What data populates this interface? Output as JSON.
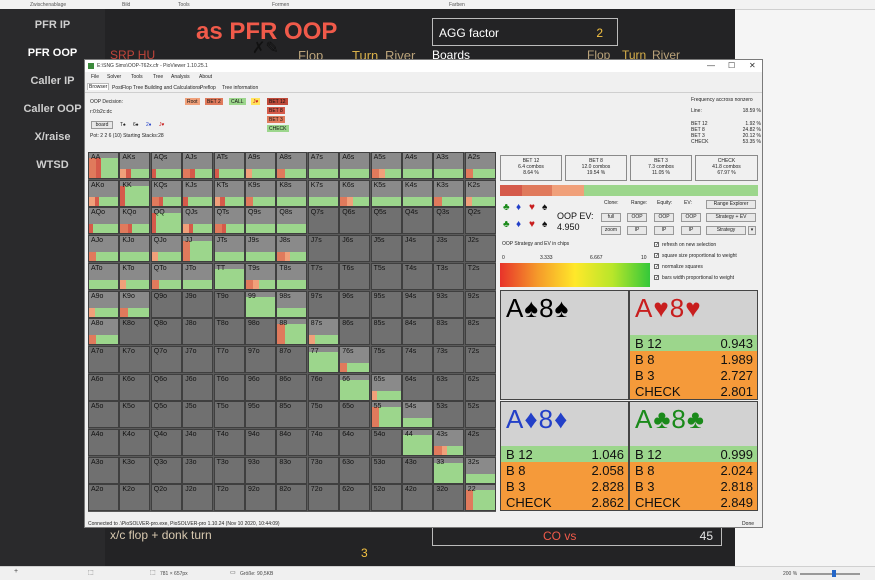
{
  "topbar": {
    "clipboard": "Zwischenablage",
    "images": "Bild",
    "tools": "Tools",
    "shapes": "Formen",
    "colors": "Farben"
  },
  "nav": {
    "items": [
      "PFR IP",
      "PFR OOP",
      "Caller IP",
      "Caller OOP",
      "X/raise",
      "WTSD"
    ]
  },
  "slide": {
    "title": "as PFR OOP",
    "srp": "SRP HU",
    "flop": "Flop",
    "turn": "Turn",
    "river": "River",
    "agg_label": "AGG factor",
    "agg_value": "2",
    "boards_label": "Boards",
    "xc": "x/c flop + donk turn",
    "three": "3",
    "co_label": "CO vs",
    "co_value": "45"
  },
  "window": {
    "title": "E:\\SNG Sims\\OOP-T62x.cfr - PioViewer 1.10.25.1",
    "minimize": "—",
    "maximize": "☐",
    "close": "✕",
    "menu": [
      "File",
      "Solver",
      "Tools",
      "Tree",
      "Analysis",
      "About"
    ],
    "tabs": [
      "Browser",
      "PostFlop Tree Building and Calculations",
      "Preflop",
      "Tree information"
    ],
    "oop_decision": "OOP Decision:",
    "node": "r:0:b2c:dc",
    "board_btn": "board",
    "board_cards": [
      "T♠",
      "6♠",
      "2♦",
      "J♥"
    ],
    "pot": "Pot: 2 2 6 (10) Starting Stacks:28",
    "tree_actions": [
      "Root",
      "BET 2",
      "CALL",
      "J♥",
      "BET 12",
      "BET 8",
      "BET 3",
      "CHECK"
    ],
    "freq_title": "Frequency accross nonzero",
    "freq": [
      {
        "k": "Line:",
        "v": "18.59 %"
      },
      {
        "k": "BET 12",
        "v": "1.92 %"
      },
      {
        "k": "BET 8",
        "v": "24.82 %"
      },
      {
        "k": "BET 3",
        "v": "20.12 %"
      },
      {
        "k": "CHECK",
        "v": "53.35 %"
      }
    ],
    "status_left": "Connected to .\\PioSOLVER-pro.exe, PioSOLVER-pro 1.10.24 (Nov 10 2020, 10:44:09)",
    "status_right": "Done"
  },
  "summary": [
    {
      "name": "BET 12",
      "combos": "6.4 combos",
      "pct": "8.64 %",
      "color": "#d55a4a"
    },
    {
      "name": "BET 8",
      "combos": "12.0 combos",
      "pct": "19.54 %",
      "color": "#e07a5c"
    },
    {
      "name": "BET 3",
      "combos": "7.3 combos",
      "pct": "11.05 %",
      "color": "#f0a07a"
    },
    {
      "name": "CHECK",
      "combos": "41.8 combos",
      "pct": "67.97 %",
      "color": "#9cd68c"
    }
  ],
  "controls": {
    "oop_ev_label": "OOP EV:",
    "oop_ev_value": "4.950",
    "clone": "Clone:",
    "range": "Range:",
    "equity": "Equity:",
    "ev": "EV:",
    "full": "full",
    "zoom": "zoom",
    "oop": "OOP",
    "ip": "IP",
    "range_explorer": "Range Explorer",
    "strategy_ev": "Strategy + EV",
    "strategy": "Strategy",
    "legend_caption": "OOP Strategy and EV in chips",
    "scale": [
      "0",
      "3.333",
      "6.667",
      "10"
    ],
    "options": [
      "refresh on new selection",
      "square size proportional to weight",
      "normalize squares",
      "bars width proportional to weight"
    ]
  },
  "hands": [
    "AA",
    "AKs",
    "AQs",
    "AJs",
    "ATs",
    "A9s",
    "A8s",
    "A7s",
    "A6s",
    "A5s",
    "A4s",
    "A3s",
    "A2s",
    "AKo",
    "KK",
    "KQs",
    "KJs",
    "KTs",
    "K9s",
    "K8s",
    "K7s",
    "K6s",
    "K5s",
    "K4s",
    "K3s",
    "K2s",
    "AQo",
    "KQo",
    "QQ",
    "QJs",
    "QTs",
    "Q9s",
    "Q8s",
    "Q7s",
    "Q6s",
    "Q5s",
    "Q4s",
    "Q3s",
    "Q2s",
    "AJo",
    "KJo",
    "QJo",
    "JJ",
    "JTs",
    "J9s",
    "J8s",
    "J7s",
    "J6s",
    "J5s",
    "J4s",
    "J3s",
    "J2s",
    "ATo",
    "KTo",
    "QTo",
    "JTo",
    "TT",
    "T9s",
    "T8s",
    "T7s",
    "T6s",
    "T5s",
    "T4s",
    "T3s",
    "T2s",
    "A9o",
    "K9o",
    "Q9o",
    "J9o",
    "T9o",
    "99",
    "98s",
    "97s",
    "96s",
    "95s",
    "94s",
    "93s",
    "92s",
    "A8o",
    "K8o",
    "Q8o",
    "J8o",
    "T8o",
    "98o",
    "88",
    "87s",
    "86s",
    "85s",
    "84s",
    "83s",
    "82s",
    "A7o",
    "K7o",
    "Q7o",
    "J7o",
    "T7o",
    "97o",
    "87o",
    "77",
    "76s",
    "75s",
    "74s",
    "73s",
    "72s",
    "A6o",
    "K6o",
    "Q6o",
    "J6o",
    "T6o",
    "96o",
    "86o",
    "76o",
    "66",
    "65s",
    "64s",
    "63s",
    "62s",
    "A5o",
    "K5o",
    "Q5o",
    "J5o",
    "T5o",
    "95o",
    "85o",
    "75o",
    "65o",
    "55",
    "54s",
    "53s",
    "52s",
    "A4o",
    "K4o",
    "Q4o",
    "J4o",
    "T4o",
    "94o",
    "84o",
    "74o",
    "64o",
    "54o",
    "44",
    "43s",
    "42s",
    "A3o",
    "K3o",
    "Q3o",
    "J3o",
    "T3o",
    "93o",
    "83o",
    "73o",
    "63o",
    "53o",
    "43o",
    "33",
    "32s",
    "A2o",
    "K2o",
    "Q2o",
    "J2o",
    "T2o",
    "92o",
    "82o",
    "72o",
    "62o",
    "52o",
    "42o",
    "32o",
    "22"
  ],
  "combos": [
    {
      "cards": "A♠8♠",
      "color": "#111111",
      "rows": []
    },
    {
      "cards": "A♥8♥",
      "color": "#c81e1e",
      "rows": [
        {
          "k": "B 12",
          "v": "0.943"
        },
        {
          "k": "B 8",
          "v": "1.989"
        },
        {
          "k": "B 3",
          "v": "2.727"
        },
        {
          "k": "CHECK",
          "v": "2.801"
        }
      ]
    },
    {
      "cards": "A♦8♦",
      "color": "#2340c8",
      "rows": [
        {
          "k": "B 12",
          "v": "1.046"
        },
        {
          "k": "B 8",
          "v": "2.058"
        },
        {
          "k": "B 3",
          "v": "2.828"
        },
        {
          "k": "CHECK",
          "v": "2.862"
        }
      ]
    },
    {
      "cards": "A♣8♣",
      "color": "#1a8a1a",
      "rows": [
        {
          "k": "B 12",
          "v": "0.999"
        },
        {
          "k": "B 8",
          "v": "2.024"
        },
        {
          "k": "B 3",
          "v": "2.818"
        },
        {
          "k": "CHECK",
          "v": "2.849"
        }
      ]
    }
  ],
  "statusbar": {
    "dims": "781 × 657px",
    "size": "Größe: 90,5KB",
    "zoom": "200 %"
  },
  "colors": {
    "check": "#9cd68c",
    "bet12": "#d55a4a",
    "bet8": "#e07a5c",
    "bet3": "#f0a07a"
  }
}
